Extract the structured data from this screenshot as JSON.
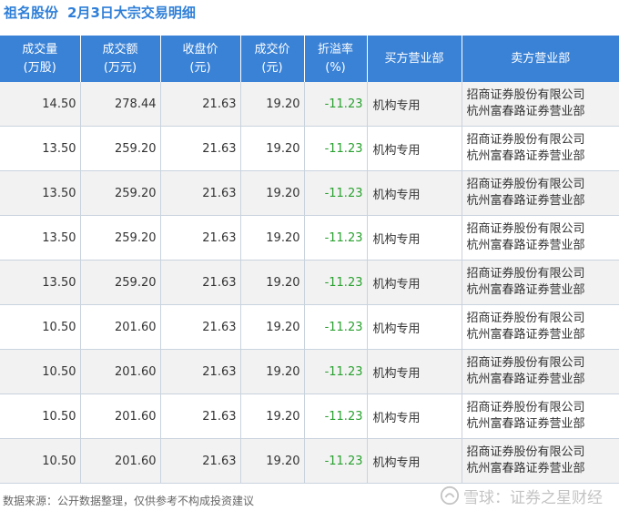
{
  "title": {
    "stock": "祖名股份",
    "date_label": "2月3日大宗交易明细"
  },
  "columns": [
    {
      "line1": "成交量",
      "line2": "(万股)"
    },
    {
      "line1": "成交额",
      "line2": "(万元)"
    },
    {
      "line1": "收盘价",
      "line2": "(元)"
    },
    {
      "line1": "成交价",
      "line2": "(元)"
    },
    {
      "line1": "折溢率",
      "line2": "(%)"
    },
    {
      "line1": "买方营业部",
      "line2": ""
    },
    {
      "line1": "卖方营业部",
      "line2": ""
    }
  ],
  "rows": [
    {
      "volume": "14.50",
      "amount": "278.44",
      "close": "21.63",
      "price": "19.20",
      "premium": "-11.23",
      "buyer": "机构专用",
      "seller_1": "招商证券股份有限公司",
      "seller_2": "杭州富春路证券营业部"
    },
    {
      "volume": "13.50",
      "amount": "259.20",
      "close": "21.63",
      "price": "19.20",
      "premium": "-11.23",
      "buyer": "机构专用",
      "seller_1": "招商证券股份有限公司",
      "seller_2": "杭州富春路证券营业部"
    },
    {
      "volume": "13.50",
      "amount": "259.20",
      "close": "21.63",
      "price": "19.20",
      "premium": "-11.23",
      "buyer": "机构专用",
      "seller_1": "招商证券股份有限公司",
      "seller_2": "杭州富春路证券营业部"
    },
    {
      "volume": "13.50",
      "amount": "259.20",
      "close": "21.63",
      "price": "19.20",
      "premium": "-11.23",
      "buyer": "机构专用",
      "seller_1": "招商证券股份有限公司",
      "seller_2": "杭州富春路证券营业部"
    },
    {
      "volume": "13.50",
      "amount": "259.20",
      "close": "21.63",
      "price": "19.20",
      "premium": "-11.23",
      "buyer": "机构专用",
      "seller_1": "招商证券股份有限公司",
      "seller_2": "杭州富春路证券营业部"
    },
    {
      "volume": "10.50",
      "amount": "201.60",
      "close": "21.63",
      "price": "19.20",
      "premium": "-11.23",
      "buyer": "机构专用",
      "seller_1": "招商证券股份有限公司",
      "seller_2": "杭州富春路证券营业部"
    },
    {
      "volume": "10.50",
      "amount": "201.60",
      "close": "21.63",
      "price": "19.20",
      "premium": "-11.23",
      "buyer": "机构专用",
      "seller_1": "招商证券股份有限公司",
      "seller_2": "杭州富春路证券营业部"
    },
    {
      "volume": "10.50",
      "amount": "201.60",
      "close": "21.63",
      "price": "19.20",
      "premium": "-11.23",
      "buyer": "机构专用",
      "seller_1": "招商证券股份有限公司",
      "seller_2": "杭州富春路证券营业部"
    },
    {
      "volume": "10.50",
      "amount": "201.60",
      "close": "21.63",
      "price": "19.20",
      "premium": "-11.23",
      "buyer": "机构专用",
      "seller_1": "招商证券股份有限公司",
      "seller_2": "杭州富春路证券营业部"
    }
  ],
  "footer": {
    "source_note": "数据来源：公开数据整理，仅供参考不构成投资建议"
  },
  "watermark": {
    "text": "证券之星"
  },
  "brand": {
    "text": "雪球：证券之星财经",
    "icon": "snowball-logo-icon"
  },
  "colors": {
    "header_bg": "#3a82d6",
    "title": "#2f7fd8",
    "negative": "#2aa130",
    "stripe": "#f2f2f2"
  }
}
